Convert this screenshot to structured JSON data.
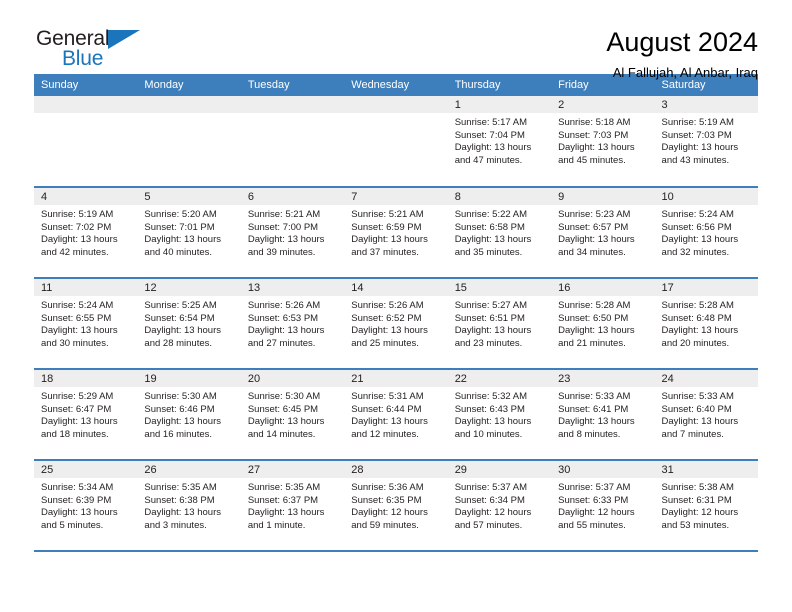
{
  "brand": {
    "name_top": "General",
    "name_bottom": "Blue",
    "accent_color": "#1b75bb",
    "text_color": "#231f20"
  },
  "header": {
    "title": "August 2024",
    "subtitle": "Al Fallujah, Al Anbar, Iraq"
  },
  "calendar": {
    "header_bg": "#3d7ebd",
    "header_text": "#ffffff",
    "daynum_band_bg": "#eeeeee",
    "weekday_headers": [
      "Sunday",
      "Monday",
      "Tuesday",
      "Wednesday",
      "Thursday",
      "Friday",
      "Saturday"
    ],
    "weeks": [
      [
        {
          "day": "",
          "sunrise": "",
          "sunset": "",
          "daylight_line1": "",
          "daylight_line2": ""
        },
        {
          "day": "",
          "sunrise": "",
          "sunset": "",
          "daylight_line1": "",
          "daylight_line2": ""
        },
        {
          "day": "",
          "sunrise": "",
          "sunset": "",
          "daylight_line1": "",
          "daylight_line2": ""
        },
        {
          "day": "",
          "sunrise": "",
          "sunset": "",
          "daylight_line1": "",
          "daylight_line2": ""
        },
        {
          "day": "1",
          "sunrise": "Sunrise: 5:17 AM",
          "sunset": "Sunset: 7:04 PM",
          "daylight_line1": "Daylight: 13 hours",
          "daylight_line2": "and 47 minutes."
        },
        {
          "day": "2",
          "sunrise": "Sunrise: 5:18 AM",
          "sunset": "Sunset: 7:03 PM",
          "daylight_line1": "Daylight: 13 hours",
          "daylight_line2": "and 45 minutes."
        },
        {
          "day": "3",
          "sunrise": "Sunrise: 5:19 AM",
          "sunset": "Sunset: 7:03 PM",
          "daylight_line1": "Daylight: 13 hours",
          "daylight_line2": "and 43 minutes."
        }
      ],
      [
        {
          "day": "4",
          "sunrise": "Sunrise: 5:19 AM",
          "sunset": "Sunset: 7:02 PM",
          "daylight_line1": "Daylight: 13 hours",
          "daylight_line2": "and 42 minutes."
        },
        {
          "day": "5",
          "sunrise": "Sunrise: 5:20 AM",
          "sunset": "Sunset: 7:01 PM",
          "daylight_line1": "Daylight: 13 hours",
          "daylight_line2": "and 40 minutes."
        },
        {
          "day": "6",
          "sunrise": "Sunrise: 5:21 AM",
          "sunset": "Sunset: 7:00 PM",
          "daylight_line1": "Daylight: 13 hours",
          "daylight_line2": "and 39 minutes."
        },
        {
          "day": "7",
          "sunrise": "Sunrise: 5:21 AM",
          "sunset": "Sunset: 6:59 PM",
          "daylight_line1": "Daylight: 13 hours",
          "daylight_line2": "and 37 minutes."
        },
        {
          "day": "8",
          "sunrise": "Sunrise: 5:22 AM",
          "sunset": "Sunset: 6:58 PM",
          "daylight_line1": "Daylight: 13 hours",
          "daylight_line2": "and 35 minutes."
        },
        {
          "day": "9",
          "sunrise": "Sunrise: 5:23 AM",
          "sunset": "Sunset: 6:57 PM",
          "daylight_line1": "Daylight: 13 hours",
          "daylight_line2": "and 34 minutes."
        },
        {
          "day": "10",
          "sunrise": "Sunrise: 5:24 AM",
          "sunset": "Sunset: 6:56 PM",
          "daylight_line1": "Daylight: 13 hours",
          "daylight_line2": "and 32 minutes."
        }
      ],
      [
        {
          "day": "11",
          "sunrise": "Sunrise: 5:24 AM",
          "sunset": "Sunset: 6:55 PM",
          "daylight_line1": "Daylight: 13 hours",
          "daylight_line2": "and 30 minutes."
        },
        {
          "day": "12",
          "sunrise": "Sunrise: 5:25 AM",
          "sunset": "Sunset: 6:54 PM",
          "daylight_line1": "Daylight: 13 hours",
          "daylight_line2": "and 28 minutes."
        },
        {
          "day": "13",
          "sunrise": "Sunrise: 5:26 AM",
          "sunset": "Sunset: 6:53 PM",
          "daylight_line1": "Daylight: 13 hours",
          "daylight_line2": "and 27 minutes."
        },
        {
          "day": "14",
          "sunrise": "Sunrise: 5:26 AM",
          "sunset": "Sunset: 6:52 PM",
          "daylight_line1": "Daylight: 13 hours",
          "daylight_line2": "and 25 minutes."
        },
        {
          "day": "15",
          "sunrise": "Sunrise: 5:27 AM",
          "sunset": "Sunset: 6:51 PM",
          "daylight_line1": "Daylight: 13 hours",
          "daylight_line2": "and 23 minutes."
        },
        {
          "day": "16",
          "sunrise": "Sunrise: 5:28 AM",
          "sunset": "Sunset: 6:50 PM",
          "daylight_line1": "Daylight: 13 hours",
          "daylight_line2": "and 21 minutes."
        },
        {
          "day": "17",
          "sunrise": "Sunrise: 5:28 AM",
          "sunset": "Sunset: 6:48 PM",
          "daylight_line1": "Daylight: 13 hours",
          "daylight_line2": "and 20 minutes."
        }
      ],
      [
        {
          "day": "18",
          "sunrise": "Sunrise: 5:29 AM",
          "sunset": "Sunset: 6:47 PM",
          "daylight_line1": "Daylight: 13 hours",
          "daylight_line2": "and 18 minutes."
        },
        {
          "day": "19",
          "sunrise": "Sunrise: 5:30 AM",
          "sunset": "Sunset: 6:46 PM",
          "daylight_line1": "Daylight: 13 hours",
          "daylight_line2": "and 16 minutes."
        },
        {
          "day": "20",
          "sunrise": "Sunrise: 5:30 AM",
          "sunset": "Sunset: 6:45 PM",
          "daylight_line1": "Daylight: 13 hours",
          "daylight_line2": "and 14 minutes."
        },
        {
          "day": "21",
          "sunrise": "Sunrise: 5:31 AM",
          "sunset": "Sunset: 6:44 PM",
          "daylight_line1": "Daylight: 13 hours",
          "daylight_line2": "and 12 minutes."
        },
        {
          "day": "22",
          "sunrise": "Sunrise: 5:32 AM",
          "sunset": "Sunset: 6:43 PM",
          "daylight_line1": "Daylight: 13 hours",
          "daylight_line2": "and 10 minutes."
        },
        {
          "day": "23",
          "sunrise": "Sunrise: 5:33 AM",
          "sunset": "Sunset: 6:41 PM",
          "daylight_line1": "Daylight: 13 hours",
          "daylight_line2": "and 8 minutes."
        },
        {
          "day": "24",
          "sunrise": "Sunrise: 5:33 AM",
          "sunset": "Sunset: 6:40 PM",
          "daylight_line1": "Daylight: 13 hours",
          "daylight_line2": "and 7 minutes."
        }
      ],
      [
        {
          "day": "25",
          "sunrise": "Sunrise: 5:34 AM",
          "sunset": "Sunset: 6:39 PM",
          "daylight_line1": "Daylight: 13 hours",
          "daylight_line2": "and 5 minutes."
        },
        {
          "day": "26",
          "sunrise": "Sunrise: 5:35 AM",
          "sunset": "Sunset: 6:38 PM",
          "daylight_line1": "Daylight: 13 hours",
          "daylight_line2": "and 3 minutes."
        },
        {
          "day": "27",
          "sunrise": "Sunrise: 5:35 AM",
          "sunset": "Sunset: 6:37 PM",
          "daylight_line1": "Daylight: 13 hours",
          "daylight_line2": "and 1 minute."
        },
        {
          "day": "28",
          "sunrise": "Sunrise: 5:36 AM",
          "sunset": "Sunset: 6:35 PM",
          "daylight_line1": "Daylight: 12 hours",
          "daylight_line2": "and 59 minutes."
        },
        {
          "day": "29",
          "sunrise": "Sunrise: 5:37 AM",
          "sunset": "Sunset: 6:34 PM",
          "daylight_line1": "Daylight: 12 hours",
          "daylight_line2": "and 57 minutes."
        },
        {
          "day": "30",
          "sunrise": "Sunrise: 5:37 AM",
          "sunset": "Sunset: 6:33 PM",
          "daylight_line1": "Daylight: 12 hours",
          "daylight_line2": "and 55 minutes."
        },
        {
          "day": "31",
          "sunrise": "Sunrise: 5:38 AM",
          "sunset": "Sunset: 6:31 PM",
          "daylight_line1": "Daylight: 12 hours",
          "daylight_line2": "and 53 minutes."
        }
      ]
    ]
  }
}
